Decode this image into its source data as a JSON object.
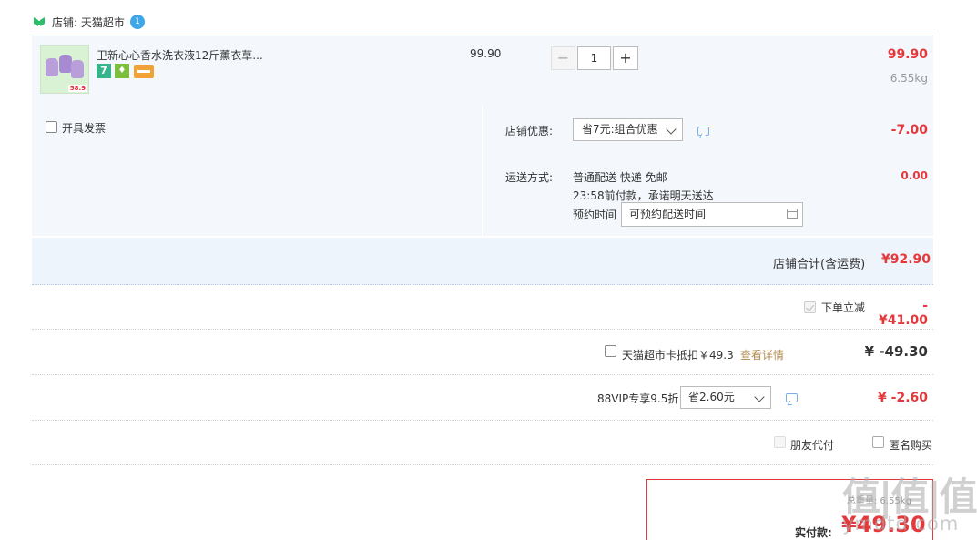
{
  "shop": {
    "label": "店铺: 天猫超市",
    "badge": "1"
  },
  "item": {
    "title": "卫新心心香水洗衣液12斤薰衣草...",
    "badges": {
      "seven": "7",
      "green": "♦"
    },
    "thumb_tag": "58.9",
    "unit_price": "99.90",
    "qty_minus": "−",
    "qty": "1",
    "qty_plus": "+",
    "total": "99.90",
    "weight": "6.55kg"
  },
  "invoice": {
    "label": "开具发票"
  },
  "promo": {
    "label": "店铺优惠:",
    "selected": "省7元:组合优惠",
    "value": "-7.00"
  },
  "shipping": {
    "label": "运送方式:",
    "line1": "普通配送 快递 免邮",
    "line2": "23:58前付款，承诺明天送达",
    "value": "0.00",
    "appointment_label": "预约时间",
    "appointment_value": "可预约配送时间"
  },
  "shop_total": {
    "label": "店铺合计(含运费)",
    "value": "¥92.90"
  },
  "instant": {
    "label": "下单立减",
    "value": "-¥41.00"
  },
  "card": {
    "label": "天猫超市卡抵扣￥49.3",
    "link": "查看详情",
    "value": "¥ -49.30"
  },
  "vip": {
    "label": "88VIP专享9.5折",
    "selected": "省2.60元",
    "value": "¥ -2.60"
  },
  "options": {
    "friend_pay": "朋友代付",
    "anonymous": "匿名购买"
  },
  "pay": {
    "weight": "总重量: 6.55kg",
    "label": "实付款:",
    "value": "¥49.30"
  },
  "watermark": {
    "logo": "值|值|值",
    "url": "ymdtd.com"
  },
  "colors": {
    "accent": "#e4393c",
    "panel": "#f4f8fd",
    "link": "#b08a50"
  }
}
